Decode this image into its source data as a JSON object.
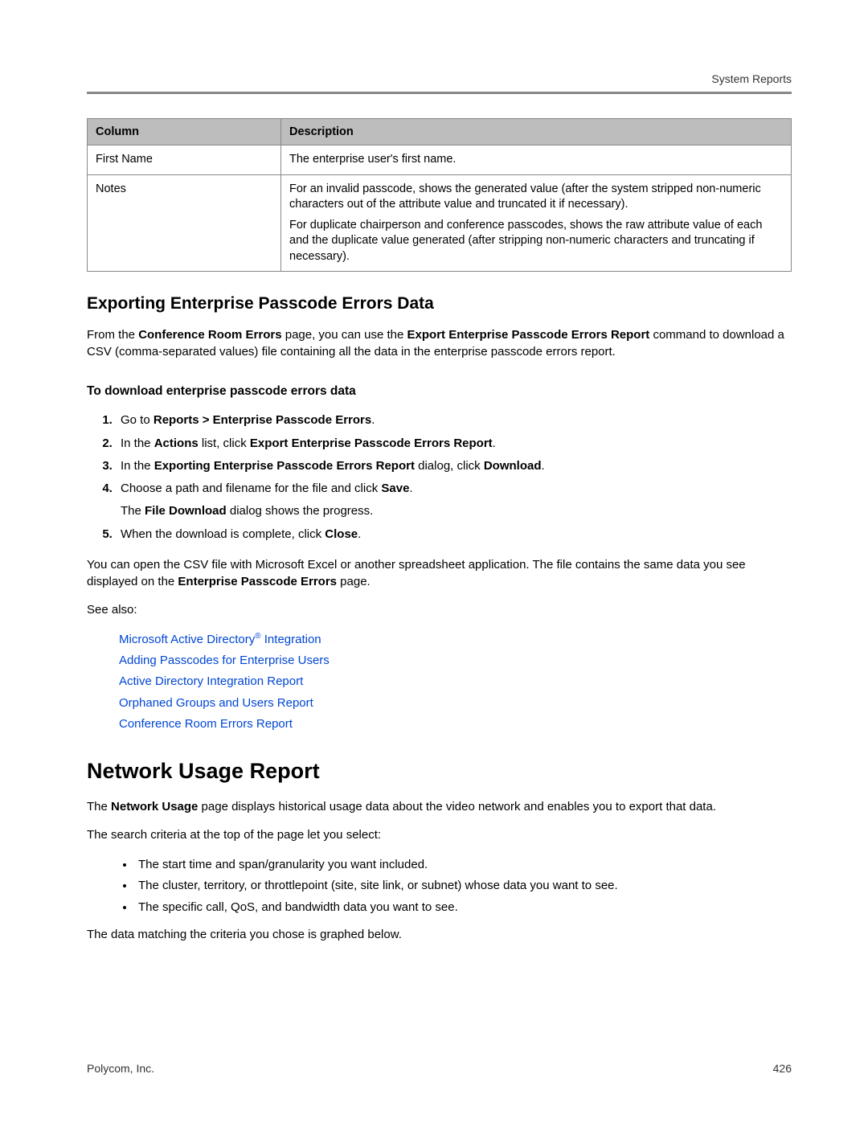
{
  "header": {
    "label": "System Reports"
  },
  "table": {
    "headers": {
      "c1": "Column",
      "c2": "Description"
    },
    "rows": [
      {
        "c1": "First Name",
        "c2": "The enterprise user's first name."
      },
      {
        "c1": "Notes",
        "c2a": "For an invalid passcode, shows the generated value (after the system stripped non-numeric characters out of the attribute value and truncated it if necessary).",
        "c2b": "For duplicate chairperson and conference passcodes, shows the raw attribute value of each and the duplicate value generated (after stripping non-numeric characters and truncating if necessary)."
      }
    ]
  },
  "section1": {
    "title": "Exporting Enterprise Passcode Errors Data",
    "intro_1": "From the ",
    "intro_b1": "Conference Room Errors",
    "intro_2": " page, you can use the ",
    "intro_b2": "Export Enterprise Passcode Errors Report",
    "intro_3": " command to download a CSV (comma-separated values) file containing all the data in the enterprise passcode errors report.",
    "sub": "To download enterprise passcode errors data",
    "steps": {
      "s1_a": "Go to ",
      "s1_b": "Reports > Enterprise Passcode Errors",
      "s1_c": ".",
      "s2_a": "In the ",
      "s2_b": "Actions",
      "s2_c": " list, click ",
      "s2_d": "Export Enterprise Passcode Errors Report",
      "s2_e": ".",
      "s3_a": "In the ",
      "s3_b": "Exporting Enterprise Passcode Errors Report",
      "s3_c": " dialog, click ",
      "s3_d": "Download",
      "s3_e": ".",
      "s4_a": "Choose a path and filename for the file and click ",
      "s4_b": "Save",
      "s4_c": ".",
      "s4_extra_a": "The ",
      "s4_extra_b": "File Download",
      "s4_extra_c": " dialog shows the progress.",
      "s5_a": "When the download is complete, click ",
      "s5_b": "Close",
      "s5_c": "."
    },
    "after_1": "You can open the CSV file with Microsoft Excel or another spreadsheet application. The file contains the same data you see displayed on the ",
    "after_b": "Enterprise Passcode Errors",
    "after_2": " page.",
    "seealso": "See also:",
    "links": [
      "Microsoft Active Directory® Integration",
      "Adding Passcodes for Enterprise Users",
      "Active Directory Integration Report",
      "Orphaned Groups and Users Report",
      "Conference Room Errors Report"
    ]
  },
  "section2": {
    "title": "Network Usage Report",
    "p1_a": "The ",
    "p1_b": "Network Usage",
    "p1_c": " page displays historical usage data about the video network and enables you to export that data.",
    "p2": "The search criteria at the top of the page let you select:",
    "bullets": [
      "The start time and span/granularity you want included.",
      "The cluster, territory, or throttlepoint (site, site link, or subnet) whose data you want to see.",
      "The specific call, QoS, and bandwidth data you want to see."
    ],
    "p3": "The data matching the criteria you chose is graphed below."
  },
  "footer": {
    "left": "Polycom, Inc.",
    "right": "426"
  }
}
